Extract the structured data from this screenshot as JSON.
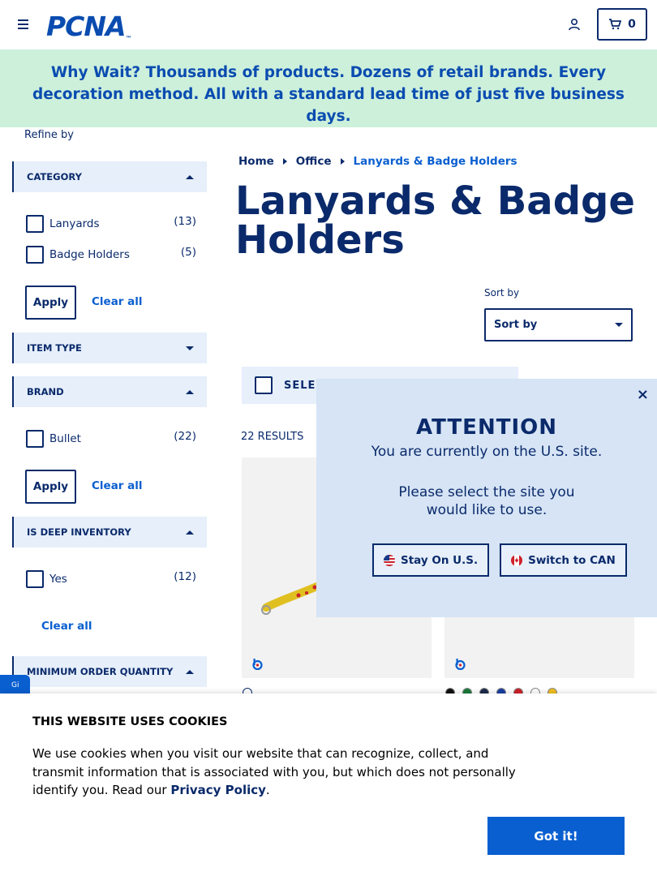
{
  "header": {
    "logo_text": "PCNA",
    "logo_tm": "™",
    "cart_count": "0"
  },
  "banner": {
    "text": "Why Wait? Thousands of products. Dozens of retail brands. Every decoration method. All with a standard lead time of just five business days."
  },
  "sidebar": {
    "refine_label": "Refine by",
    "category": {
      "title": "CATEGORY",
      "options": [
        {
          "label": "Lanyards",
          "count": "(13)"
        },
        {
          "label": "Badge Holders",
          "count": "(5)"
        }
      ],
      "apply": "Apply",
      "clear": "Clear all"
    },
    "item_type": {
      "title": "ITEM TYPE"
    },
    "brand": {
      "title": "BRAND",
      "options": [
        {
          "label": "Bullet",
          "count": "(22)"
        }
      ],
      "apply": "Apply",
      "clear": "Clear all"
    },
    "deep_inventory": {
      "title": "IS DEEP INVENTORY",
      "options": [
        {
          "label": "Yes",
          "count": "(12)"
        }
      ],
      "clear": "Clear all"
    },
    "moq": {
      "title": "MINIMUM ORDER QUANTITY"
    }
  },
  "breadcrumb": {
    "home": "Home",
    "office": "Office",
    "current": "Lanyards & Badge Holders"
  },
  "page_title": "Lanyards & Badge Holders",
  "sort": {
    "label": "Sort by",
    "value": "Sort by"
  },
  "select_all": "SELEC",
  "results": "22 RESULTS",
  "swatches": {
    "card1": [
      "#ffffff"
    ],
    "card2": [
      "#111111",
      "#1a7a3a",
      "#1b2a4a",
      "#1a3fa0",
      "#d0202a",
      "#ffffff",
      "#f2c01e"
    ]
  },
  "modal": {
    "title": "ATTENTION",
    "line1": "You are currently on the U.S. site.",
    "line2": "Please select the site you",
    "line3": "would like to use.",
    "stay": "Stay On U.S.",
    "switch": "Switch to CAN",
    "close": "×"
  },
  "cookie": {
    "title": "THIS WEBSITE USES COOKIES",
    "text": "We use cookies when you visit our website that can recognize, collect, and transmit information that is associated with you, but which does not personally identify you. Read our",
    "link": "Privacy Policy",
    "period": ".",
    "button": "Got it!"
  },
  "side_tab": "Gi"
}
